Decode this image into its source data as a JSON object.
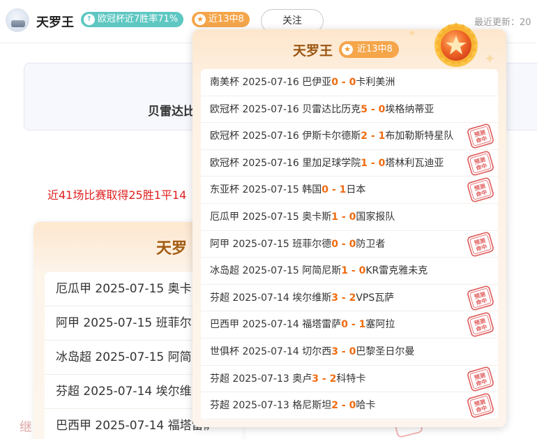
{
  "header": {
    "name": "天罗王",
    "badge_win": "欧冠杯近7胜率71%",
    "badge_hit": "近13中8",
    "follow_label": "关注",
    "update_text": "最近更新：20"
  },
  "background": {
    "card_text": "贝雷达比",
    "record_text": "近41场比赛取得25胜1平14",
    "side_text": "继",
    "back_popup": {
      "title": "天罗",
      "rows": [
        "厄瓜甲 2025-07-15 奥卡",
        "阿甲 2025-07-15 班菲尔",
        "冰岛超 2025-07-15 阿简",
        "芬超 2025-07-14 埃尔维",
        "巴西甲 2025-07-14 福塔雷萨"
      ]
    }
  },
  "popup": {
    "title": "天罗王",
    "badge": "近13中8",
    "stamp_text": "预测命中",
    "matches": [
      {
        "league": "南美杯",
        "date": "2025-07-16",
        "home": "巴伊亚",
        "hs": "0",
        "as": "0",
        "away": "卡利美洲",
        "hit": false
      },
      {
        "league": "欧冠杯",
        "date": "2025-07-16",
        "home": "贝雷达比历克",
        "hs": "5",
        "as": "0",
        "away": "埃格纳蒂亚",
        "hit": false
      },
      {
        "league": "欧冠杯",
        "date": "2025-07-16",
        "home": "伊斯卡尔德斯",
        "hs": "2",
        "as": "1",
        "away": "布加勒斯特星队",
        "hit": true
      },
      {
        "league": "欧冠杯",
        "date": "2025-07-16",
        "home": "里加足球学院",
        "hs": "1",
        "as": "0",
        "away": "塔林利瓦迪亚",
        "hit": true
      },
      {
        "league": "东亚杯",
        "date": "2025-07-15",
        "home": "韩国",
        "hs": "0",
        "as": "1",
        "away": "日本",
        "hit": true
      },
      {
        "league": "厄瓜甲",
        "date": "2025-07-15",
        "home": "奥卡斯",
        "hs": "1",
        "as": "0",
        "away": "国家报队",
        "hit": false
      },
      {
        "league": "阿甲",
        "date": "2025-07-15",
        "home": "班菲尔德",
        "hs": "0",
        "as": "0",
        "away": "防卫者",
        "hit": true
      },
      {
        "league": "冰岛超",
        "date": "2025-07-15",
        "home": "阿简尼斯",
        "hs": "1",
        "as": "0",
        "away": "KR雷克雅未克",
        "hit": false
      },
      {
        "league": "芬超",
        "date": "2025-07-14",
        "home": "埃尔维斯",
        "hs": "3",
        "as": "2",
        "away": "VPS瓦萨",
        "hit": true
      },
      {
        "league": "巴西甲",
        "date": "2025-07-14",
        "home": "福塔雷萨",
        "hs": "0",
        "as": "1",
        "away": "塞阿拉",
        "hit": true
      },
      {
        "league": "世俱杯",
        "date": "2025-07-14",
        "home": "切尔西",
        "hs": "3",
        "as": "0",
        "away": "巴黎圣日尔曼",
        "hit": false
      },
      {
        "league": "芬超",
        "date": "2025-07-13",
        "home": "奥卢",
        "hs": "3",
        "as": "2",
        "away": "科特卡",
        "hit": true
      },
      {
        "league": "芬超",
        "date": "2025-07-13",
        "home": "格尼斯坦",
        "hs": "2",
        "as": "0",
        "away": "哈卡",
        "hit": true
      }
    ]
  },
  "colors": {
    "score": "#f06a0f",
    "stamp": "#e05a5a",
    "title": "#9a5513",
    "badge_win": "#5ec7c2",
    "badge_hit": "#f5a54a"
  },
  "icons": {
    "badge_win": "arrow-up-icon",
    "badge_hit": "star-icon",
    "medal": "medal-star-icon"
  }
}
